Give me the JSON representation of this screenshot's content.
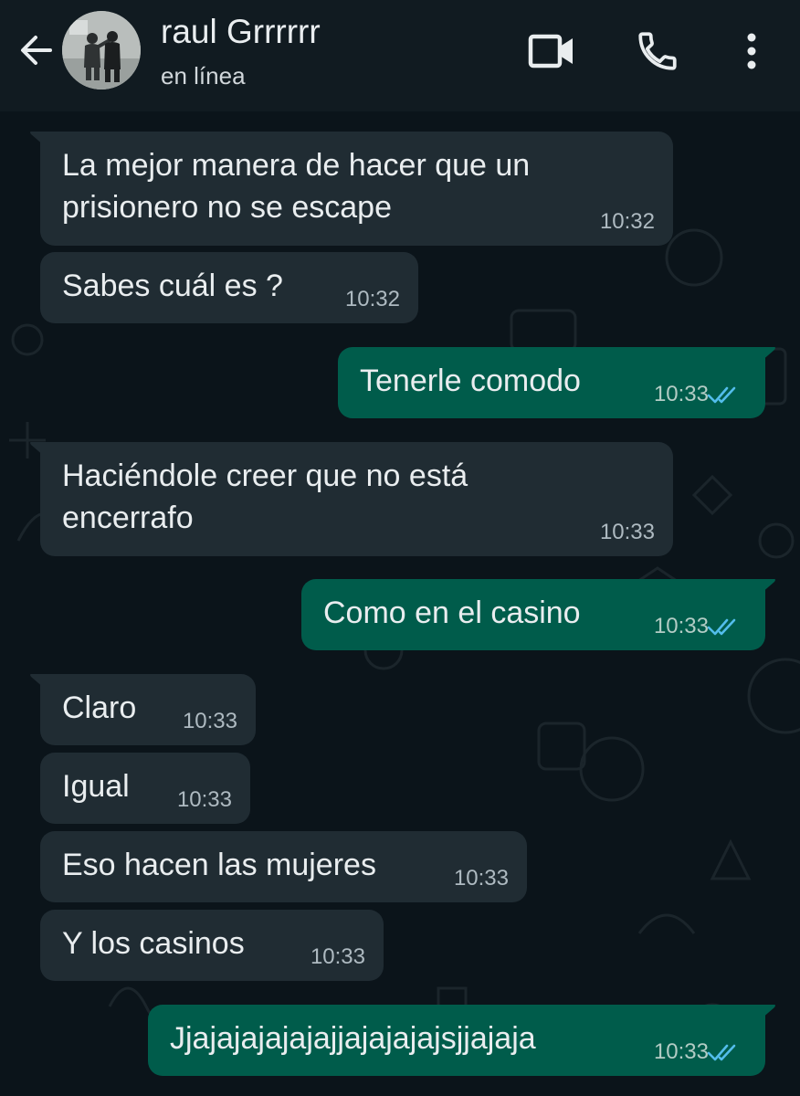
{
  "header": {
    "contact_name": "raul Grrrrrr",
    "status": "en línea"
  },
  "icons": {
    "back": "arrow-left-icon",
    "video": "video-camera-icon",
    "call": "phone-icon",
    "menu": "more-vertical-icon",
    "read_receipt": "double-check-icon"
  },
  "colors": {
    "header_bg": "#111b21",
    "chat_bg": "#0b141a",
    "incoming_bubble": "#202c33",
    "outgoing_bubble": "#005c4b",
    "read_tick": "#53bdeb"
  },
  "messages": [
    {
      "direction": "in",
      "lines": [
        "La mejor manera de hacer que un",
        "prisionero no se escape"
      ],
      "time": "10:32"
    },
    {
      "direction": "in",
      "lines": [
        "Sabes cuál es ?"
      ],
      "time": "10:32"
    },
    {
      "direction": "out",
      "lines": [
        "Tenerle comodo"
      ],
      "time": "10:33",
      "read": true
    },
    {
      "direction": "in",
      "lines": [
        "Haciéndole creer que no está",
        "encerrafo"
      ],
      "time": "10:33"
    },
    {
      "direction": "out",
      "lines": [
        "Como en el casino"
      ],
      "time": "10:33",
      "read": true
    },
    {
      "direction": "in",
      "lines": [
        "Claro"
      ],
      "time": "10:33"
    },
    {
      "direction": "in",
      "lines": [
        "Igual"
      ],
      "time": "10:33"
    },
    {
      "direction": "in",
      "lines": [
        "Eso hacen las mujeres"
      ],
      "time": "10:33"
    },
    {
      "direction": "in",
      "lines": [
        "Y los casinos"
      ],
      "time": "10:33"
    },
    {
      "direction": "out",
      "lines": [
        "Jjajajajajajajjajajajajsjjajaja"
      ],
      "time": "10:33",
      "read": true
    }
  ]
}
